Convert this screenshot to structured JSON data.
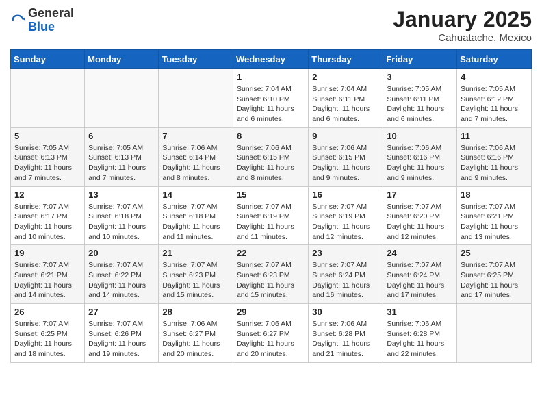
{
  "header": {
    "logo_general": "General",
    "logo_blue": "Blue",
    "month_year": "January 2025",
    "location": "Cahuatache, Mexico"
  },
  "weekdays": [
    "Sunday",
    "Monday",
    "Tuesday",
    "Wednesday",
    "Thursday",
    "Friday",
    "Saturday"
  ],
  "weeks": [
    [
      {
        "day": "",
        "info": ""
      },
      {
        "day": "",
        "info": ""
      },
      {
        "day": "",
        "info": ""
      },
      {
        "day": "1",
        "info": "Sunrise: 7:04 AM\nSunset: 6:10 PM\nDaylight: 11 hours and 6 minutes."
      },
      {
        "day": "2",
        "info": "Sunrise: 7:04 AM\nSunset: 6:11 PM\nDaylight: 11 hours and 6 minutes."
      },
      {
        "day": "3",
        "info": "Sunrise: 7:05 AM\nSunset: 6:11 PM\nDaylight: 11 hours and 6 minutes."
      },
      {
        "day": "4",
        "info": "Sunrise: 7:05 AM\nSunset: 6:12 PM\nDaylight: 11 hours and 7 minutes."
      }
    ],
    [
      {
        "day": "5",
        "info": "Sunrise: 7:05 AM\nSunset: 6:13 PM\nDaylight: 11 hours and 7 minutes."
      },
      {
        "day": "6",
        "info": "Sunrise: 7:05 AM\nSunset: 6:13 PM\nDaylight: 11 hours and 7 minutes."
      },
      {
        "day": "7",
        "info": "Sunrise: 7:06 AM\nSunset: 6:14 PM\nDaylight: 11 hours and 8 minutes."
      },
      {
        "day": "8",
        "info": "Sunrise: 7:06 AM\nSunset: 6:15 PM\nDaylight: 11 hours and 8 minutes."
      },
      {
        "day": "9",
        "info": "Sunrise: 7:06 AM\nSunset: 6:15 PM\nDaylight: 11 hours and 9 minutes."
      },
      {
        "day": "10",
        "info": "Sunrise: 7:06 AM\nSunset: 6:16 PM\nDaylight: 11 hours and 9 minutes."
      },
      {
        "day": "11",
        "info": "Sunrise: 7:06 AM\nSunset: 6:16 PM\nDaylight: 11 hours and 9 minutes."
      }
    ],
    [
      {
        "day": "12",
        "info": "Sunrise: 7:07 AM\nSunset: 6:17 PM\nDaylight: 11 hours and 10 minutes."
      },
      {
        "day": "13",
        "info": "Sunrise: 7:07 AM\nSunset: 6:18 PM\nDaylight: 11 hours and 10 minutes."
      },
      {
        "day": "14",
        "info": "Sunrise: 7:07 AM\nSunset: 6:18 PM\nDaylight: 11 hours and 11 minutes."
      },
      {
        "day": "15",
        "info": "Sunrise: 7:07 AM\nSunset: 6:19 PM\nDaylight: 11 hours and 11 minutes."
      },
      {
        "day": "16",
        "info": "Sunrise: 7:07 AM\nSunset: 6:19 PM\nDaylight: 11 hours and 12 minutes."
      },
      {
        "day": "17",
        "info": "Sunrise: 7:07 AM\nSunset: 6:20 PM\nDaylight: 11 hours and 12 minutes."
      },
      {
        "day": "18",
        "info": "Sunrise: 7:07 AM\nSunset: 6:21 PM\nDaylight: 11 hours and 13 minutes."
      }
    ],
    [
      {
        "day": "19",
        "info": "Sunrise: 7:07 AM\nSunset: 6:21 PM\nDaylight: 11 hours and 14 minutes."
      },
      {
        "day": "20",
        "info": "Sunrise: 7:07 AM\nSunset: 6:22 PM\nDaylight: 11 hours and 14 minutes."
      },
      {
        "day": "21",
        "info": "Sunrise: 7:07 AM\nSunset: 6:23 PM\nDaylight: 11 hours and 15 minutes."
      },
      {
        "day": "22",
        "info": "Sunrise: 7:07 AM\nSunset: 6:23 PM\nDaylight: 11 hours and 15 minutes."
      },
      {
        "day": "23",
        "info": "Sunrise: 7:07 AM\nSunset: 6:24 PM\nDaylight: 11 hours and 16 minutes."
      },
      {
        "day": "24",
        "info": "Sunrise: 7:07 AM\nSunset: 6:24 PM\nDaylight: 11 hours and 17 minutes."
      },
      {
        "day": "25",
        "info": "Sunrise: 7:07 AM\nSunset: 6:25 PM\nDaylight: 11 hours and 17 minutes."
      }
    ],
    [
      {
        "day": "26",
        "info": "Sunrise: 7:07 AM\nSunset: 6:25 PM\nDaylight: 11 hours and 18 minutes."
      },
      {
        "day": "27",
        "info": "Sunrise: 7:07 AM\nSunset: 6:26 PM\nDaylight: 11 hours and 19 minutes."
      },
      {
        "day": "28",
        "info": "Sunrise: 7:06 AM\nSunset: 6:27 PM\nDaylight: 11 hours and 20 minutes."
      },
      {
        "day": "29",
        "info": "Sunrise: 7:06 AM\nSunset: 6:27 PM\nDaylight: 11 hours and 20 minutes."
      },
      {
        "day": "30",
        "info": "Sunrise: 7:06 AM\nSunset: 6:28 PM\nDaylight: 11 hours and 21 minutes."
      },
      {
        "day": "31",
        "info": "Sunrise: 7:06 AM\nSunset: 6:28 PM\nDaylight: 11 hours and 22 minutes."
      },
      {
        "day": "",
        "info": ""
      }
    ]
  ]
}
